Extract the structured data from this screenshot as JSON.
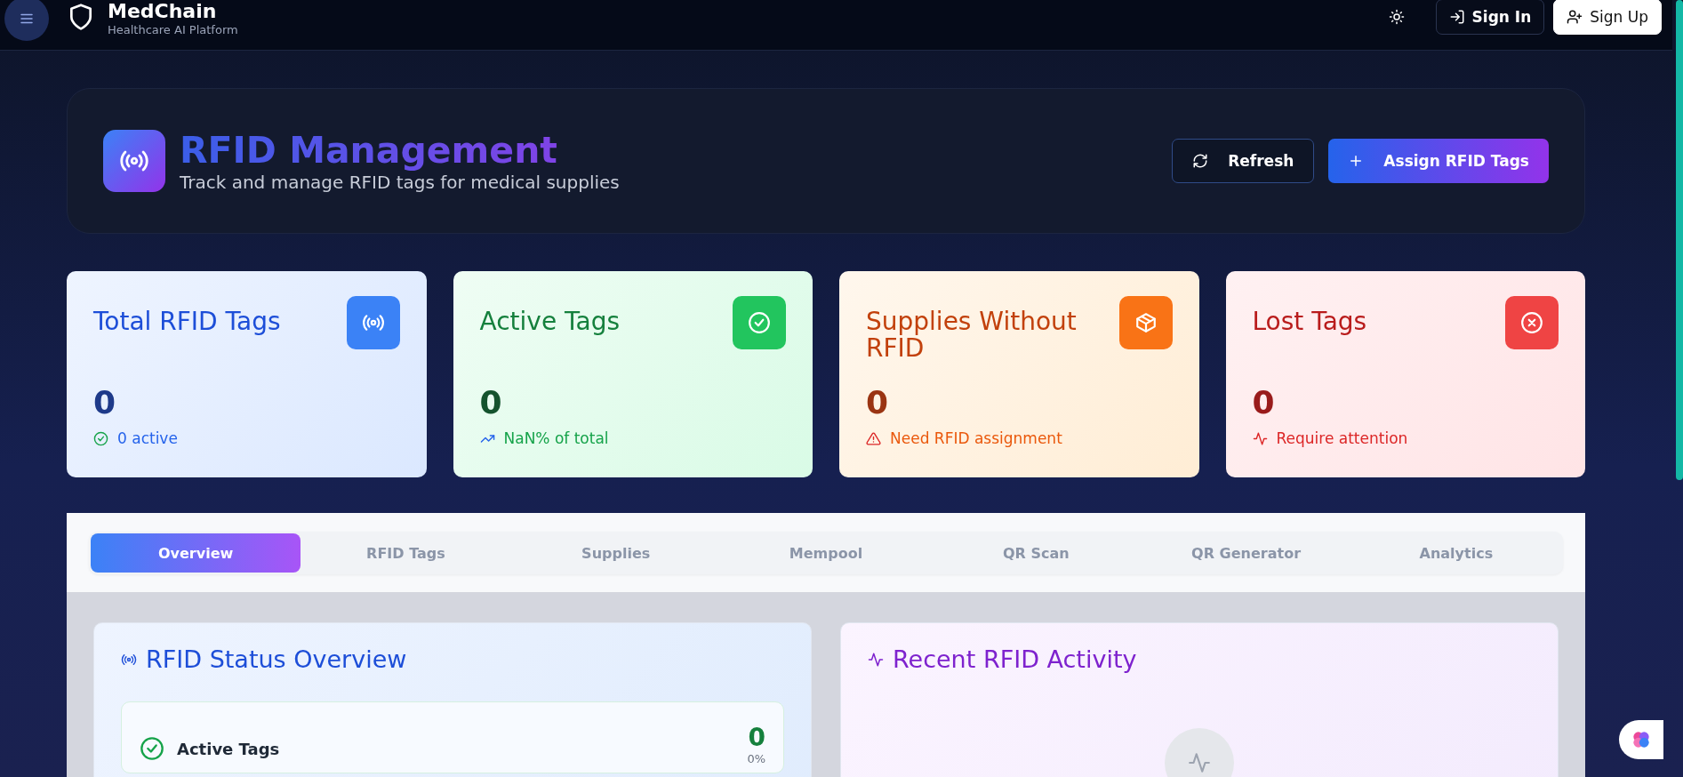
{
  "topbar": {
    "brand": "MedChain",
    "tagline": "Healthcare AI Platform",
    "buttons": [
      {
        "kind": "signin",
        "label": "Sign In"
      },
      {
        "kind": "signup",
        "label": "Sign Up"
      }
    ]
  },
  "header": {
    "title": "RFID Management",
    "subtitle": "Track and manage RFID tags for medical supplies",
    "buttons": [
      {
        "kind": "refresh",
        "label": "Refresh"
      },
      {
        "kind": "assign",
        "label": "Assign RFID Tags"
      }
    ]
  },
  "stats": [
    {
      "kind": "total",
      "title": "Total RFID Tags",
      "value": "0",
      "note": "0 active"
    },
    {
      "kind": "active",
      "title": "Active Tags",
      "value": "0",
      "note": "NaN% of total"
    },
    {
      "kind": "missing",
      "title": "Supplies Without RFID",
      "value": "0",
      "note": "Need RFID assignment"
    },
    {
      "kind": "lost",
      "title": "Lost Tags",
      "value": "0",
      "note": "Require attention"
    }
  ],
  "tabs": [
    {
      "label": "Overview",
      "selected": true
    },
    {
      "label": "RFID Tags",
      "selected": false
    },
    {
      "label": "Supplies",
      "selected": false
    },
    {
      "label": "Mempool",
      "selected": false
    },
    {
      "label": "QR Scan",
      "selected": false
    },
    {
      "label": "QR Generator",
      "selected": false
    },
    {
      "label": "Analytics",
      "selected": false
    }
  ],
  "status_overview": {
    "title": "RFID Status Overview",
    "rows": [
      {
        "label": "Active Tags",
        "value": "0",
        "percent": "0%"
      }
    ]
  },
  "recent_activity": {
    "title": "Recent RFID Activity"
  }
}
